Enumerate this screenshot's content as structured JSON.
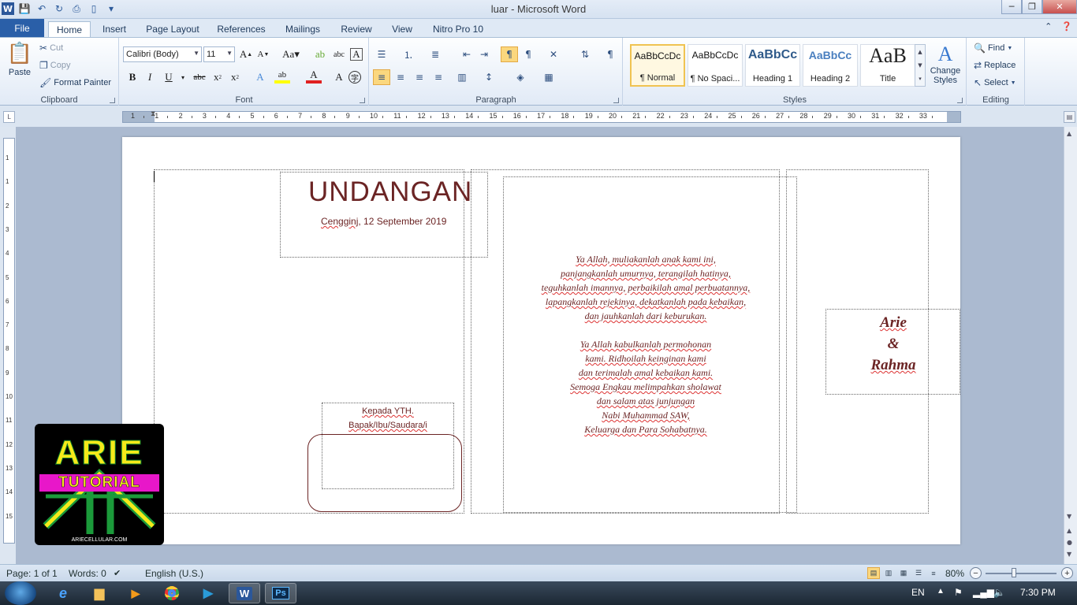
{
  "window": {
    "title": "luar  -  Microsoft Word",
    "minimize": "─",
    "maximize": "❐",
    "close": "✕"
  },
  "tabs": [
    {
      "label": "File"
    },
    {
      "label": "Home"
    },
    {
      "label": "Insert"
    },
    {
      "label": "Page Layout"
    },
    {
      "label": "References"
    },
    {
      "label": "Mailings"
    },
    {
      "label": "Review"
    },
    {
      "label": "View"
    },
    {
      "label": "Nitro Pro 10"
    }
  ],
  "clipboard": {
    "label": "Clipboard",
    "paste": "Paste",
    "cut": "Cut",
    "copy": "Copy",
    "format_painter": "Format Painter"
  },
  "font": {
    "label": "Font",
    "family": "Calibri (Body)",
    "size": "11"
  },
  "paragraph": {
    "label": "Paragraph"
  },
  "styles": {
    "label": "Styles",
    "items": [
      {
        "preview": "AaBbCcDc",
        "name": "¶ Normal"
      },
      {
        "preview": "AaBbCcDc",
        "name": "¶ No Spaci..."
      },
      {
        "preview": "AaBbCc",
        "name": "Heading 1"
      },
      {
        "preview": "AaBbCc",
        "name": "Heading 2"
      },
      {
        "preview": "AaB",
        "name": "Title"
      }
    ],
    "change_styles": "Change Styles"
  },
  "editing": {
    "label": "Editing",
    "find": "Find",
    "replace": "Replace",
    "select": "Select"
  },
  "ruler": {
    "numbers": [
      "1",
      "1",
      "2",
      "3",
      "4",
      "5",
      "6",
      "7",
      "8",
      "9",
      "10",
      "11",
      "12",
      "13",
      "14",
      "15",
      "16",
      "17",
      "18",
      "19",
      "20",
      "21",
      "22",
      "23",
      "24",
      "25",
      "26",
      "27",
      "28",
      "29",
      "30",
      "31",
      "32",
      "33"
    ],
    "v_numbers": [
      "1",
      "1",
      "2",
      "3",
      "4",
      "5",
      "6",
      "7",
      "8",
      "9",
      "10",
      "11",
      "12",
      "13",
      "14",
      "15"
    ]
  },
  "document": {
    "heading": "UNDANGAN",
    "date_place": "Cengginj",
    "date_rest": ", 12 September 2019",
    "prayer_lines": [
      "Ya Allah, muliakanlah anak kami ini,",
      "panjangkanlah umurnya, terangilah hatinya,",
      "teguhkanlah imannya, perbaikilah amal perbuatannya,",
      "lapangkanlah rejekinya, dekatkanlah pada kebaikan,",
      "dan jauhkanlah  dari keburukan.",
      "",
      "Ya Allah kabulkanlah permohonan",
      "kami. Ridhoilah keinginan kami",
      "dan terimalah amal kebaikan kami.",
      "Semoga Engkau melimpahkan sholawat",
      "dan salam atas junjungan",
      "Nabi Muhammad SAW,",
      "Keluarga dan  Para Sohabatnya."
    ],
    "name1": "Arie",
    "ampersand": "&",
    "name2": "Rahma",
    "kepada": "Kepada YTH.",
    "recipient": "Bapak/Ibu/Saudara/i"
  },
  "logo": {
    "big": "ARIE",
    "tutorial": "TUTORIAL",
    "site": "ARIECELLULAR.COM"
  },
  "status": {
    "page": "Page: 1 of 1",
    "words": "Words: 0",
    "language": "English (U.S.)",
    "zoom": "80%",
    "zoom_level": 0.8
  },
  "taskbar": {
    "lang": "EN",
    "time": "7:30 PM"
  }
}
